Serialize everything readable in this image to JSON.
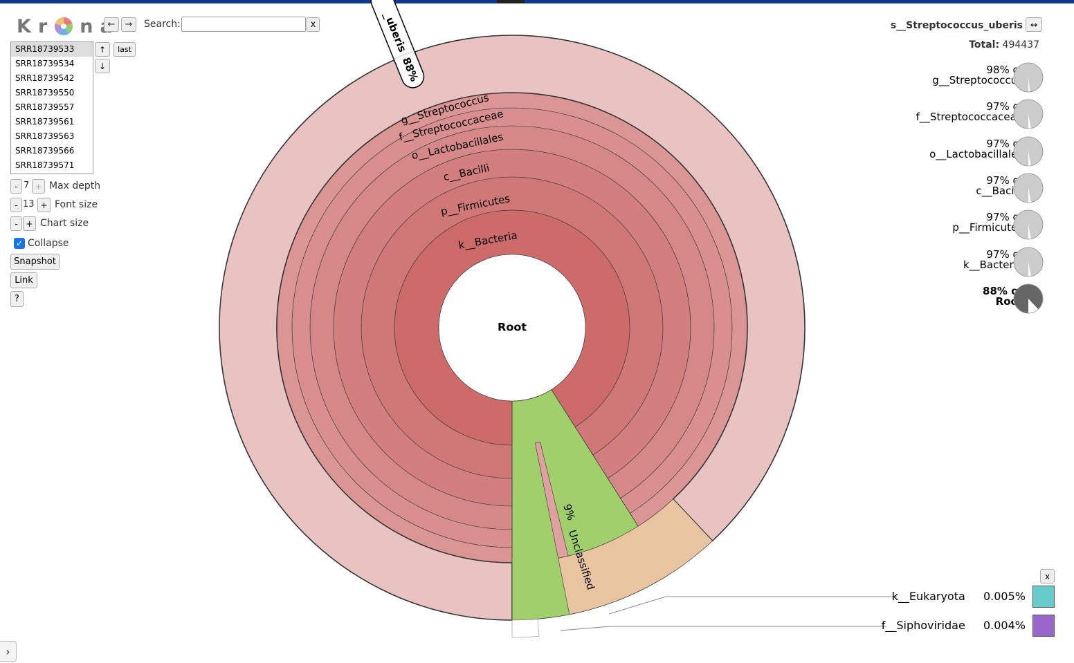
{
  "app": {
    "logo_letters": [
      "K",
      "r",
      "n",
      "a"
    ],
    "back_label": "←",
    "forward_label": "→",
    "search_label": "Search:",
    "search_value": "",
    "search_clear_label": "x"
  },
  "datasets": {
    "items": [
      "SRR18739533",
      "SRR18739534",
      "SRR18739542",
      "SRR18739550",
      "SRR18739557",
      "SRR18739561",
      "SRR18739563",
      "SRR18739566",
      "SRR18739571"
    ],
    "selected_index": 0,
    "up_label": "↑",
    "down_label": "↓",
    "last_label": "last"
  },
  "controls": {
    "minus_label": "-",
    "plus_label": "+",
    "max_depth_value": "7",
    "max_depth_label": "Max depth",
    "font_size_value": "13",
    "font_size_label": "Font size",
    "chart_size_label": "Chart size",
    "collapse_checked": true,
    "collapse_label": "Collapse",
    "snapshot_label": "Snapshot",
    "link_label": "Link",
    "help_label": "?"
  },
  "details": {
    "selected_name": "s__Streptococcus_uberis",
    "expand_label": "↔",
    "total_label": "Total:",
    "total_value": "494437",
    "ancestors": [
      {
        "percent": "98% of",
        "name": "g__Streptococcus",
        "fraction": 0.98,
        "bold": false
      },
      {
        "percent": "97% of",
        "name": "f__Streptococcaceae",
        "fraction": 0.97,
        "bold": false
      },
      {
        "percent": "97% of",
        "name": "o__Lactobacillales",
        "fraction": 0.97,
        "bold": false
      },
      {
        "percent": "97% of",
        "name": "c__Bacilli",
        "fraction": 0.97,
        "bold": false
      },
      {
        "percent": "97% of",
        "name": "p__Firmicutes",
        "fraction": 0.97,
        "bold": false
      },
      {
        "percent": "97% of",
        "name": "k__Bacteria",
        "fraction": 0.97,
        "bold": false
      },
      {
        "percent": "88% of",
        "name": "Root",
        "fraction": 0.88,
        "bold": true
      }
    ]
  },
  "chart_data": {
    "type": "sunburst",
    "center_label": "Root",
    "selected_label": "s__Streptococcus_uberis",
    "selected_percent": "88%",
    "selected_tag_text": "_uberis",
    "unclassified": {
      "name": "Unclassified",
      "percent": "9%",
      "fraction": 0.09
    },
    "rings": [
      {
        "name": "k__Bacteria",
        "fraction": 0.97,
        "color": "#cd6b6b"
      },
      {
        "name": "p__Firmicutes",
        "fraction": 0.94,
        "color": "#d07878"
      },
      {
        "name": "c__Bacilli",
        "fraction": 0.94,
        "color": "#d37f7f"
      },
      {
        "name": "o__Lactobacillales",
        "fraction": 0.94,
        "color": "#d68888"
      },
      {
        "name": "f__Streptococcaceae",
        "fraction": 0.94,
        "color": "#d98f8f"
      },
      {
        "name": "g__Streptococcus",
        "fraction": 0.92,
        "color": "#dc9595"
      },
      {
        "name": "s__Streptococcus_uberis",
        "fraction": 0.88,
        "color": "#e9c2c2"
      }
    ],
    "colors": {
      "unclassified": "#a1cf6b",
      "other_species": "#e8c4a0",
      "other_genus": "#e0a0a0",
      "pie_light": "#cccccc",
      "pie_dark": "#666666"
    },
    "hidden_items": [
      {
        "name": "k__Eukaryota",
        "percent": "0.005%",
        "color": "#66cccc"
      },
      {
        "name": "f__Siphoviridae",
        "percent": "0.004%",
        "color": "#9966cc"
      }
    ],
    "hidden_close_label": "x"
  }
}
